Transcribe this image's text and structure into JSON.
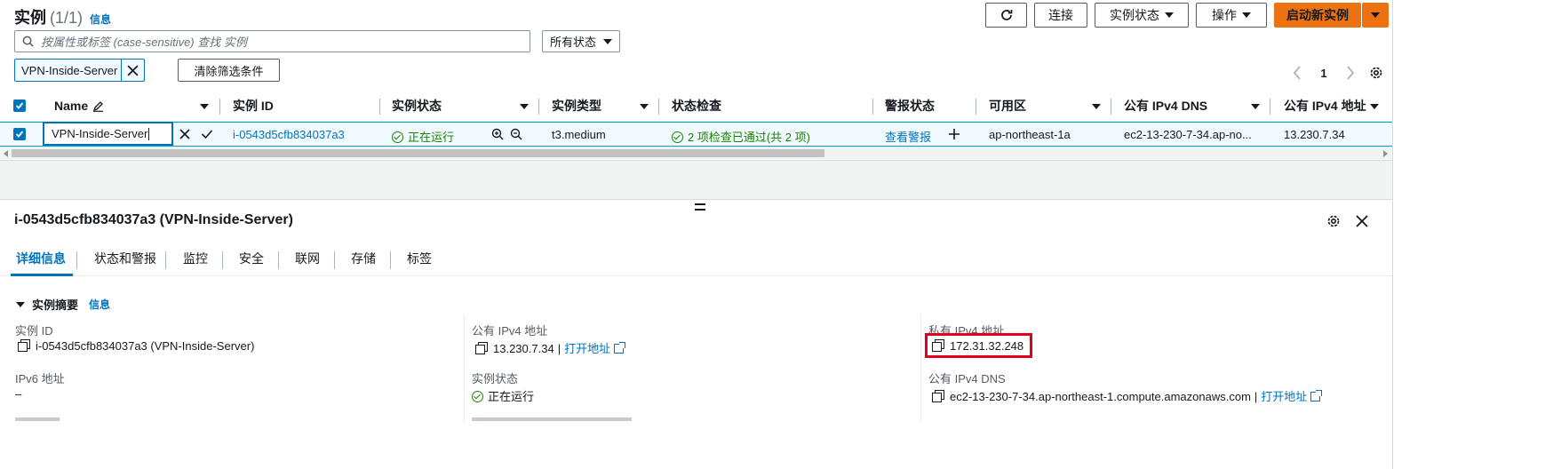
{
  "header": {
    "title": "实例",
    "count": "(1/1)",
    "info": "信息",
    "connect": "连接",
    "instance_state": "实例状态",
    "actions": "操作",
    "launch": "启动新实例"
  },
  "filter": {
    "placeholder": "按属性或标签 (case-sensitive) 查找 实例",
    "status_select": "所有状态",
    "token": "VPN-Inside-Server",
    "clear": "清除筛选条件",
    "page": "1"
  },
  "table": {
    "columns": [
      "Name",
      "实例 ID",
      "实例状态",
      "实例类型",
      "状态检查",
      "警报状态",
      "可用区",
      "公有 IPv4 DNS",
      "公有 IPv4 地址"
    ],
    "row": {
      "name_edit": "VPN-Inside-Server",
      "instance_id": "i-0543d5cfb834037a3",
      "state": "正在运行",
      "type": "t3.medium",
      "checks": "2 项检查已通过(共 2 项)",
      "alarm": "查看警报",
      "az": "ap-northeast-1a",
      "dns": "ec2-13-230-7-34.ap-no...",
      "ipv4": "13.230.7.34"
    }
  },
  "detail": {
    "title": "i-0543d5cfb834037a3 (VPN-Inside-Server)",
    "tabs": [
      "详细信息",
      "状态和警报",
      "监控",
      "安全",
      "联网",
      "存储",
      "标签"
    ],
    "section": "实例摘要",
    "section_info": "信息",
    "instance_id_label": "实例 ID",
    "instance_id_value": "i-0543d5cfb834037a3 (VPN-Inside-Server)",
    "ipv6_label": "IPv6 地址",
    "ipv6_value": "–",
    "public_ipv4_label": "公有 IPv4 地址",
    "public_ipv4_value": "13.230.7.34",
    "open_address": "打开地址",
    "state_label": "实例状态",
    "state_value": "正在运行",
    "private_ipv4_label": "私有 IPv4 地址",
    "private_ipv4_value": "172.31.32.248",
    "public_dns_label": "公有 IPv4 DNS",
    "public_dns_value": "ec2-13-230-7-34.ap-northeast-1.compute.amazonaws.com",
    "open_address2": "打开地址"
  },
  "colors": {
    "accent": "#0073bb",
    "launch": "#ec7211",
    "success": "#1d8102",
    "highlight": "#e0001b"
  }
}
